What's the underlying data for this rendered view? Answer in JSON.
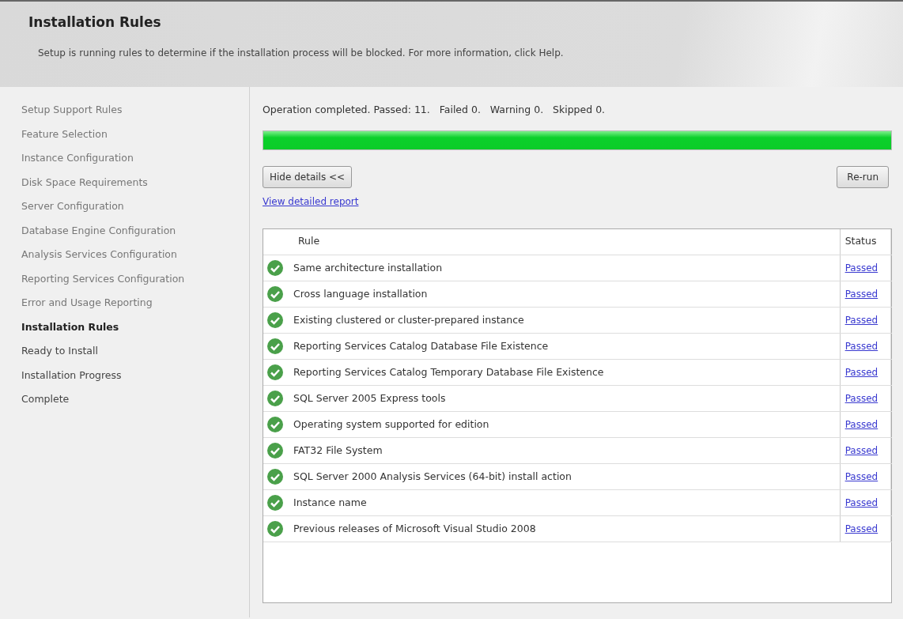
{
  "header": {
    "title": "Installation Rules",
    "subtitle": "Setup is running rules to determine if the installation process will be blocked. For more information, click Help."
  },
  "sidebar": {
    "items": [
      {
        "label": "Setup Support Rules",
        "selected": false,
        "done": true
      },
      {
        "label": "Feature Selection",
        "selected": false,
        "done": true
      },
      {
        "label": "Instance Configuration",
        "selected": false,
        "done": true
      },
      {
        "label": "Disk Space Requirements",
        "selected": false,
        "done": true
      },
      {
        "label": "Server Configuration",
        "selected": false,
        "done": true
      },
      {
        "label": "Database Engine Configuration",
        "selected": false,
        "done": true
      },
      {
        "label": "Analysis Services Configuration",
        "selected": false,
        "done": true
      },
      {
        "label": "Reporting Services Configuration",
        "selected": false,
        "done": true
      },
      {
        "label": "Error and Usage Reporting",
        "selected": false,
        "done": true
      },
      {
        "label": "Installation Rules",
        "selected": true,
        "done": false
      },
      {
        "label": "Ready to Install",
        "selected": false,
        "done": false
      },
      {
        "label": "Installation Progress",
        "selected": false,
        "done": false
      },
      {
        "label": "Complete",
        "selected": false,
        "done": false
      }
    ]
  },
  "main": {
    "status_text": "Operation completed. Passed: 11.   Failed 0.   Warning 0.   Skipped 0.",
    "progress": {
      "level": 1
    },
    "hide_details_button": "Hide details <<",
    "rerun_button": "Re-run",
    "report_link": "View detailed report",
    "table": {
      "columns": [
        "Rule",
        "Status"
      ],
      "rows": [
        {
          "rule": "Same architecture installation",
          "status": "Passed"
        },
        {
          "rule": "Cross language installation",
          "status": "Passed"
        },
        {
          "rule": "Existing clustered or cluster-prepared instance",
          "status": "Passed"
        },
        {
          "rule": "Reporting Services Catalog Database File Existence",
          "status": "Passed"
        },
        {
          "rule": "Reporting Services Catalog Temporary Database File Existence",
          "status": "Passed"
        },
        {
          "rule": "SQL Server 2005 Express tools",
          "status": "Passed"
        },
        {
          "rule": "Operating system supported for edition",
          "status": "Passed"
        },
        {
          "rule": "FAT32 File System",
          "status": "Passed"
        },
        {
          "rule": "SQL Server 2000 Analysis Services (64-bit) install action",
          "status": "Passed"
        },
        {
          "rule": "Instance name",
          "status": "Passed"
        },
        {
          "rule": "Previous releases of Microsoft Visual Studio 2008",
          "status": "Passed"
        }
      ]
    }
  }
}
